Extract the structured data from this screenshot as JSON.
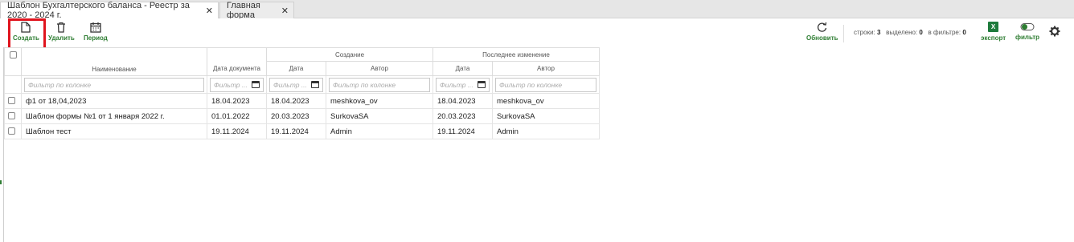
{
  "tabs": [
    {
      "label": "Шаблон Бухгалтерского баланса - Реестр за 2020 - 2024 г.",
      "active": true
    },
    {
      "label": "Главная форма",
      "active": false
    }
  ],
  "toolbar": {
    "create_label": "Создать",
    "delete_label": "Удалить",
    "period_label": "Период",
    "refresh_label": "Обновить",
    "export_label": "экспорт",
    "filter_label": "фильтр",
    "export_icon_text": "X"
  },
  "stats": {
    "rows_label": "строки:",
    "rows_value": "3",
    "selected_label": "выделено:",
    "selected_value": "0",
    "filtered_label": "в фильтре:",
    "filtered_value": "0"
  },
  "table": {
    "headers": {
      "name": "Наименование",
      "doc_date": "Дата документа",
      "creation_group": "Создание",
      "last_change_group": "Последнее изменение",
      "date": "Дата",
      "author": "Автор"
    },
    "filter_placeholder": "Фильтр по колонке",
    "filter_placeholder_short": "Фильтр ...",
    "rows": [
      {
        "name": "ф1 от 18,04,2023",
        "doc_date": "18.04.2023",
        "created_date": "18.04.2023",
        "created_author": "meshkova_ov",
        "changed_date": "18.04.2023",
        "changed_author": "meshkova_ov"
      },
      {
        "name": "Шаблон формы №1 от 1 января 2022 г.",
        "doc_date": "01.01.2022",
        "created_date": "20.03.2023",
        "created_author": "SurkovaSA",
        "changed_date": "20.03.2023",
        "changed_author": "SurkovaSA"
      },
      {
        "name": "Шаблон тест",
        "doc_date": "19.11.2024",
        "created_date": "19.11.2024",
        "created_author": "Admin",
        "changed_date": "19.11.2024",
        "changed_author": "Admin"
      }
    ]
  },
  "colors": {
    "accent_green": "#2e7d32",
    "highlight_red": "#e0141e",
    "excel_green": "#1e7b3c"
  }
}
